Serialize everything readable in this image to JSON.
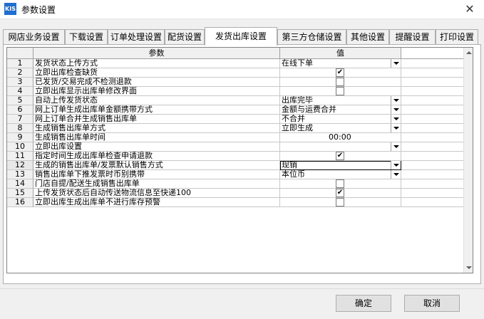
{
  "window": {
    "icon_text": "KIS",
    "title": "参数设置",
    "close_glyph": "✕"
  },
  "tabs": [
    {
      "label": "网店业务设置"
    },
    {
      "label": "下载设置"
    },
    {
      "label": "订单处理设置"
    },
    {
      "label": "配货设置"
    },
    {
      "label": "发货出库设置"
    },
    {
      "label": "第三方仓储设置"
    },
    {
      "label": "其他设置"
    },
    {
      "label": "提醒设置"
    },
    {
      "label": "打印设置"
    }
  ],
  "active_tab": "发货出库设置",
  "grid": {
    "headers": {
      "num": "",
      "param": "参数",
      "value": "值"
    },
    "rows": [
      {
        "num": "1",
        "param": "发货状态上传方式",
        "type": "dropdown",
        "value": "在线下单"
      },
      {
        "num": "2",
        "param": "立即出库检查缺货",
        "type": "checkbox",
        "checked": true
      },
      {
        "num": "3",
        "param": "已发货/交易完成不检测退款",
        "type": "checkbox",
        "checked": false
      },
      {
        "num": "4",
        "param": "立即出库显示出库单修改界面",
        "type": "checkbox",
        "checked": false
      },
      {
        "num": "5",
        "param": "自动上传发货状态",
        "type": "dropdown",
        "value": "出库完毕"
      },
      {
        "num": "6",
        "param": "网上订单生成出库单金额携带方式",
        "type": "dropdown",
        "value": "金额与运费合并"
      },
      {
        "num": "7",
        "param": "网上订单合并生成销售出库单",
        "type": "dropdown",
        "value": "不合并"
      },
      {
        "num": "8",
        "param": "生成销售出库单方式",
        "type": "dropdown",
        "value": "立即生成"
      },
      {
        "num": "9",
        "param": "生成销售出库单时间",
        "type": "time",
        "value": "00:00"
      },
      {
        "num": "10",
        "param": "立即出库设置",
        "type": "dropdown",
        "value": ""
      },
      {
        "num": "11",
        "param": "指定时间生成出库单检查申请退款",
        "type": "checkbox",
        "checked": true
      },
      {
        "num": "12",
        "param": "生成的销售出库单/发票默认销售方式",
        "type": "dropdown",
        "value": "现销",
        "focused": true
      },
      {
        "num": "13",
        "param": "销售出库单下推发票时币别携带",
        "type": "dropdown",
        "value": "本位币"
      },
      {
        "num": "14",
        "param": "门店自提/配送生成销售出库单",
        "type": "checkbox",
        "checked": false
      },
      {
        "num": "15",
        "param": "上传发货状态后自动传送物流信息至快递100",
        "type": "checkbox",
        "checked": true
      },
      {
        "num": "16",
        "param": "立即出库生成出库单不进行库存预警",
        "type": "checkbox",
        "checked": false
      }
    ]
  },
  "buttons": {
    "ok": "确定",
    "cancel": "取消"
  },
  "check_glyph": "✔"
}
